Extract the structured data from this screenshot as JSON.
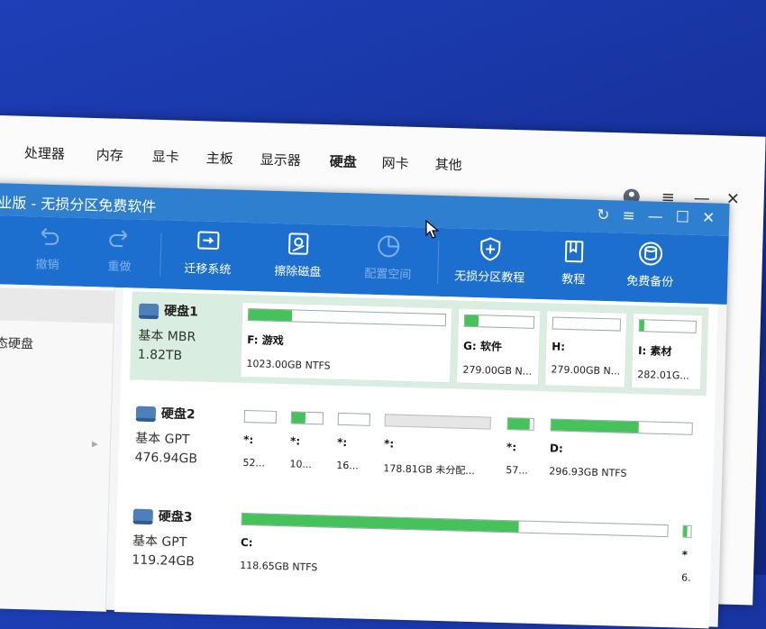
{
  "back_window": {
    "tabs": [
      "处理器",
      "内存",
      "显卡",
      "主板",
      "显示器",
      "硬盘",
      "网卡",
      "其他"
    ],
    "active_tab": "硬盘",
    "controls": [
      "≡",
      "—",
      "✕"
    ]
  },
  "app": {
    "title": "业版 - 无损分区免费软件",
    "title_controls": [
      "↻",
      "≡",
      "—",
      "☐",
      "✕"
    ]
  },
  "toolbar": {
    "items": [
      {
        "label": "撤销",
        "icon": "undo-icon",
        "enabled": false
      },
      {
        "label": "重做",
        "icon": "redo-icon",
        "enabled": false
      },
      {
        "label": "迁移系统",
        "icon": "migrate-icon",
        "enabled": true
      },
      {
        "label": "擦除磁盘",
        "icon": "wipe-disk-icon",
        "enabled": true
      },
      {
        "label": "配置空间",
        "icon": "pie-icon",
        "enabled": false
      },
      {
        "label": "无损分区教程",
        "icon": "shield-plus-icon",
        "enabled": true
      },
      {
        "label": "教程",
        "icon": "book-icon",
        "enabled": true
      },
      {
        "label": "免费备份",
        "icon": "backup-icon",
        "enabled": true
      }
    ]
  },
  "sidebar": {
    "item": "态硬盘"
  },
  "disks": [
    {
      "name": "硬盘1",
      "type": "基本 MBR",
      "size": "1.82TB",
      "partitions": [
        {
          "label": "F: 游戏",
          "size": "1023.00GB NTFS",
          "fill": 0.22
        },
        {
          "label": "G: 软件",
          "size": "279.00GB N...",
          "fill": 0.2
        },
        {
          "label": "H:",
          "size": "279.00GB N...",
          "fill": 0.0
        },
        {
          "label": "I: 素材",
          "size": "282.01G...",
          "fill": 0.08
        }
      ]
    },
    {
      "name": "硬盘2",
      "type": "基本 GPT",
      "size": "476.94GB",
      "partitions": [
        {
          "label": "*:",
          "size": "52...",
          "fill": 0.0
        },
        {
          "label": "*:",
          "size": "10...",
          "fill": 0.45
        },
        {
          "label": "*:",
          "size": "16...",
          "fill": 0.0
        },
        {
          "label": "*:",
          "size": "178.81GB 未分配...",
          "fill": 0.0
        },
        {
          "label": "*:",
          "size": "57...",
          "fill": 0.85
        },
        {
          "label": "D:",
          "size": "296.93GB NTFS",
          "fill": 0.62
        }
      ]
    },
    {
      "name": "硬盘3",
      "type": "基本 GPT",
      "size": "119.24GB",
      "partitions": [
        {
          "label": "C:",
          "size": "118.65GB NTFS",
          "fill": 0.65
        },
        {
          "label": "*",
          "size": "6.",
          "fill": 0.5
        }
      ]
    }
  ]
}
